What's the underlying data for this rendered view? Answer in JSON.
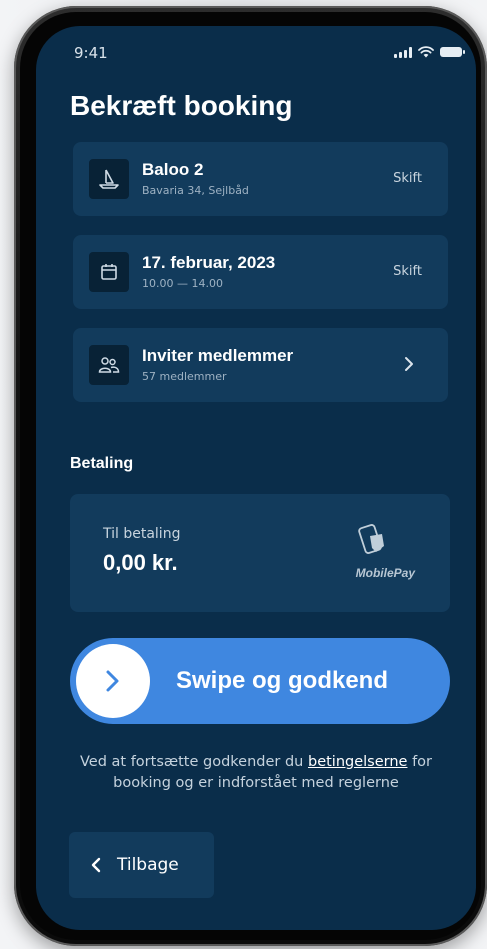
{
  "status_bar": {
    "time": "9:41"
  },
  "page": {
    "title": "Bekræft booking"
  },
  "cards": [
    {
      "title": "Baloo 2",
      "subtitle": "Bavaria 34, Sejlbåd",
      "action": "Skift",
      "icon": "sailboat-icon"
    },
    {
      "title": "17. februar, 2023",
      "subtitle": "10.00 — 14.00",
      "action": "Skift",
      "icon": "calendar-icon"
    },
    {
      "title": "Inviter medlemmer",
      "subtitle": "57 medlemmer",
      "icon": "users-icon"
    }
  ],
  "payment": {
    "section_title": "Betaling",
    "label": "Til betaling",
    "amount": "0,00 kr.",
    "method": "MobilePay"
  },
  "swipe": {
    "label": "Swipe og godkend"
  },
  "terms": {
    "prefix": "Ved at fortsætte godkender du ",
    "link": "betingelserne",
    "suffix": " for booking og er indforstået med reglerne"
  },
  "back": {
    "label": "Tilbage"
  },
  "colors": {
    "background": "#0a2d4a",
    "card": "#123b5c",
    "accent": "#3f87e0",
    "text": "#ffffff"
  }
}
